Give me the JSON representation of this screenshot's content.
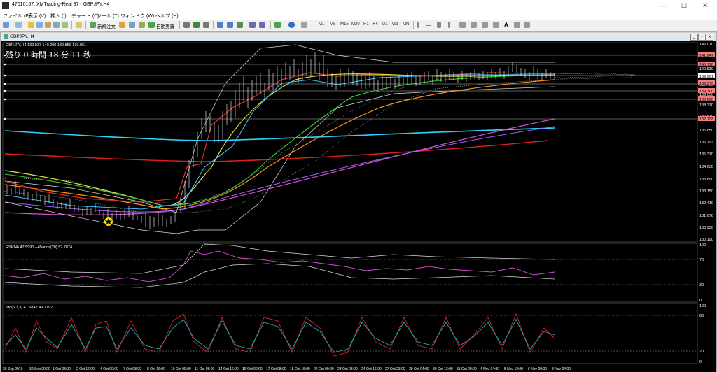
{
  "window": {
    "title": "47010157: XMTrading-Real 37 - GBPJPY,H4"
  },
  "menu": [
    "ファイル (F)",
    "表示 (V)",
    "挿入 (I)",
    "チャート (C)",
    "ツール (T)",
    "ウィンドウ (W)",
    "ヘルプ (H)"
  ],
  "toolbar": {
    "new_order": "新規注文",
    "auto_trade": "自動売買",
    "timeframes": [
      "M1",
      "M5",
      "M15",
      "M30",
      "H1",
      "H4",
      "D1",
      "W1",
      "MN"
    ]
  },
  "chart_window": {
    "title": "GBPJPY,H4"
  },
  "main_panel": {
    "info": "GBPJPY,H4  139.937 140.000 139.859 139.961",
    "countdown": "残り 0 時間 18 分 11 秒",
    "price_ticks": [
      "142.010",
      "140.530",
      "139.790",
      "139.050",
      "138.310",
      "137.570",
      "136.850",
      "136.110",
      "135.370",
      "134.630",
      "133.890",
      "133.150",
      "132.410",
      "131.670",
      "130.930",
      "130.190"
    ],
    "level_labels": [
      "141.247",
      "140.798",
      "139.961",
      "139.573",
      "139.100",
      "138.608",
      "137.112"
    ],
    "colors": {
      "level_bg": "#f08080",
      "current_bg": "#ffffff"
    }
  },
  "rsi_panel": {
    "label": "RSI(14) 47.5990  ++Bands(20) 52.7874",
    "ticks": [
      "100",
      "70",
      "30",
      "0"
    ]
  },
  "stoch_panel": {
    "label": "Sto(5,3,3) 41.6842 49.7792",
    "ticks": [
      "100",
      "80",
      "20",
      "0"
    ]
  },
  "time_axis": [
    "26 Sep 2019",
    "30 Sep 00:00",
    "1 Oct 08:00",
    "2 Oct 16:00",
    "4 Oct 00:00",
    "7 Oct 08:00",
    "8 Oct 16:00",
    "10 Oct 00:00",
    "11 Oct 08:00",
    "14 Oct 16:00",
    "16 Oct 00:00",
    "17 Oct 08:00",
    "18 Oct 16:00",
    "22 Oct 00:00",
    "23 Oct 08:00",
    "24 Oct 16:00",
    "27 Oct 23:00",
    "29 Oct 04:00",
    "30 Oct 12:00",
    "31 Oct 20:00",
    "4 Nov 04:00",
    "5 Nov 12:00",
    "6 Nov 20:00",
    "8 Nov 04:00"
  ]
}
